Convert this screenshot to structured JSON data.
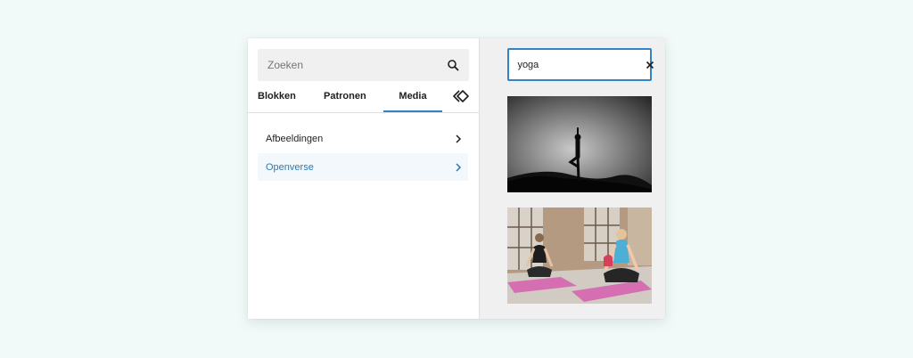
{
  "inserter": {
    "search": {
      "placeholder": "Zoeken"
    },
    "tabs": [
      {
        "label": "Blokken",
        "active": false
      },
      {
        "label": "Patronen",
        "active": false
      },
      {
        "label": "Media",
        "active": true
      }
    ],
    "tab_icon": "reusable-blocks-icon",
    "media_categories": [
      {
        "label": "Afbeeldingen",
        "active": false
      },
      {
        "label": "Openverse",
        "active": true
      }
    ]
  },
  "media_panel": {
    "search": {
      "value": "yoga"
    },
    "results": [
      {
        "icon": "yoga-silhouette-photo"
      },
      {
        "icon": "yoga-meditation-photo"
      }
    ]
  },
  "colors": {
    "accent": "#3582c4",
    "active_category_text": "#2d79b0",
    "background": "#f1faf9"
  }
}
